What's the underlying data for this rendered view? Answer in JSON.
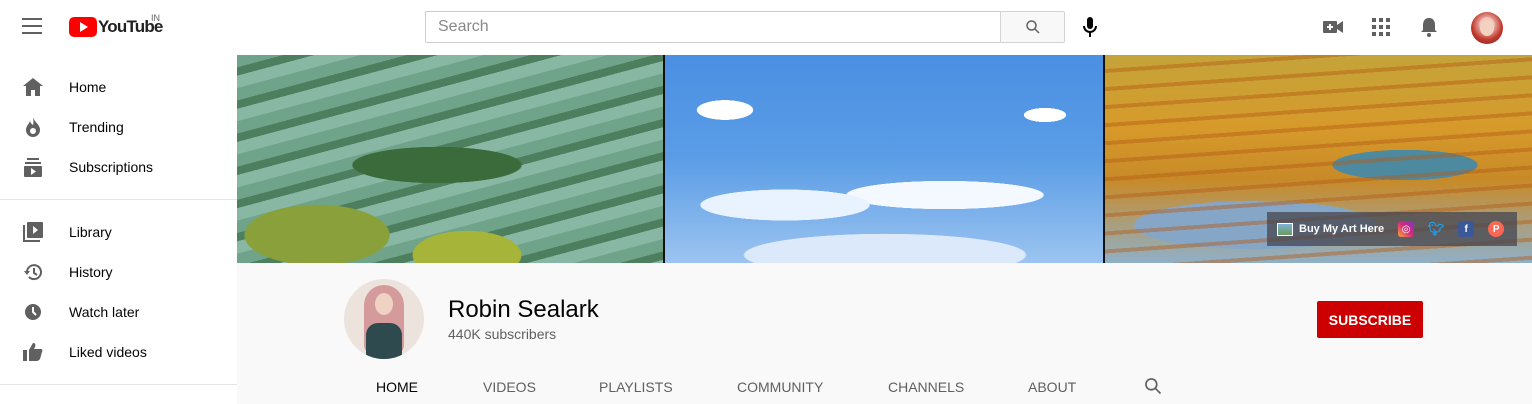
{
  "topbar": {
    "logo_text": "YouTube",
    "region": "IN",
    "search_placeholder": "Search"
  },
  "sidebar": {
    "items": [
      {
        "label": "Home",
        "icon": "home-icon"
      },
      {
        "label": "Trending",
        "icon": "flame-icon"
      },
      {
        "label": "Subscriptions",
        "icon": "subscriptions-icon"
      },
      {
        "label": "Library",
        "icon": "library-icon"
      },
      {
        "label": "History",
        "icon": "history-icon"
      },
      {
        "label": "Watch later",
        "icon": "clock-icon"
      },
      {
        "label": "Liked videos",
        "icon": "thumbs-up-icon"
      }
    ]
  },
  "banner": {
    "link_label": "Buy My Art Here",
    "social": [
      "instagram-icon",
      "twitter-icon",
      "facebook-icon",
      "patreon-icon"
    ]
  },
  "channel": {
    "name": "Robin Sealark",
    "subscribers": "440K subscribers",
    "subscribe_label": "SUBSCRIBE"
  },
  "tabs": [
    "HOME",
    "VIDEOS",
    "PLAYLISTS",
    "COMMUNITY",
    "CHANNELS",
    "ABOUT"
  ],
  "colors": {
    "brand_red": "#ff0000",
    "subscribe_red": "#cc0000"
  }
}
